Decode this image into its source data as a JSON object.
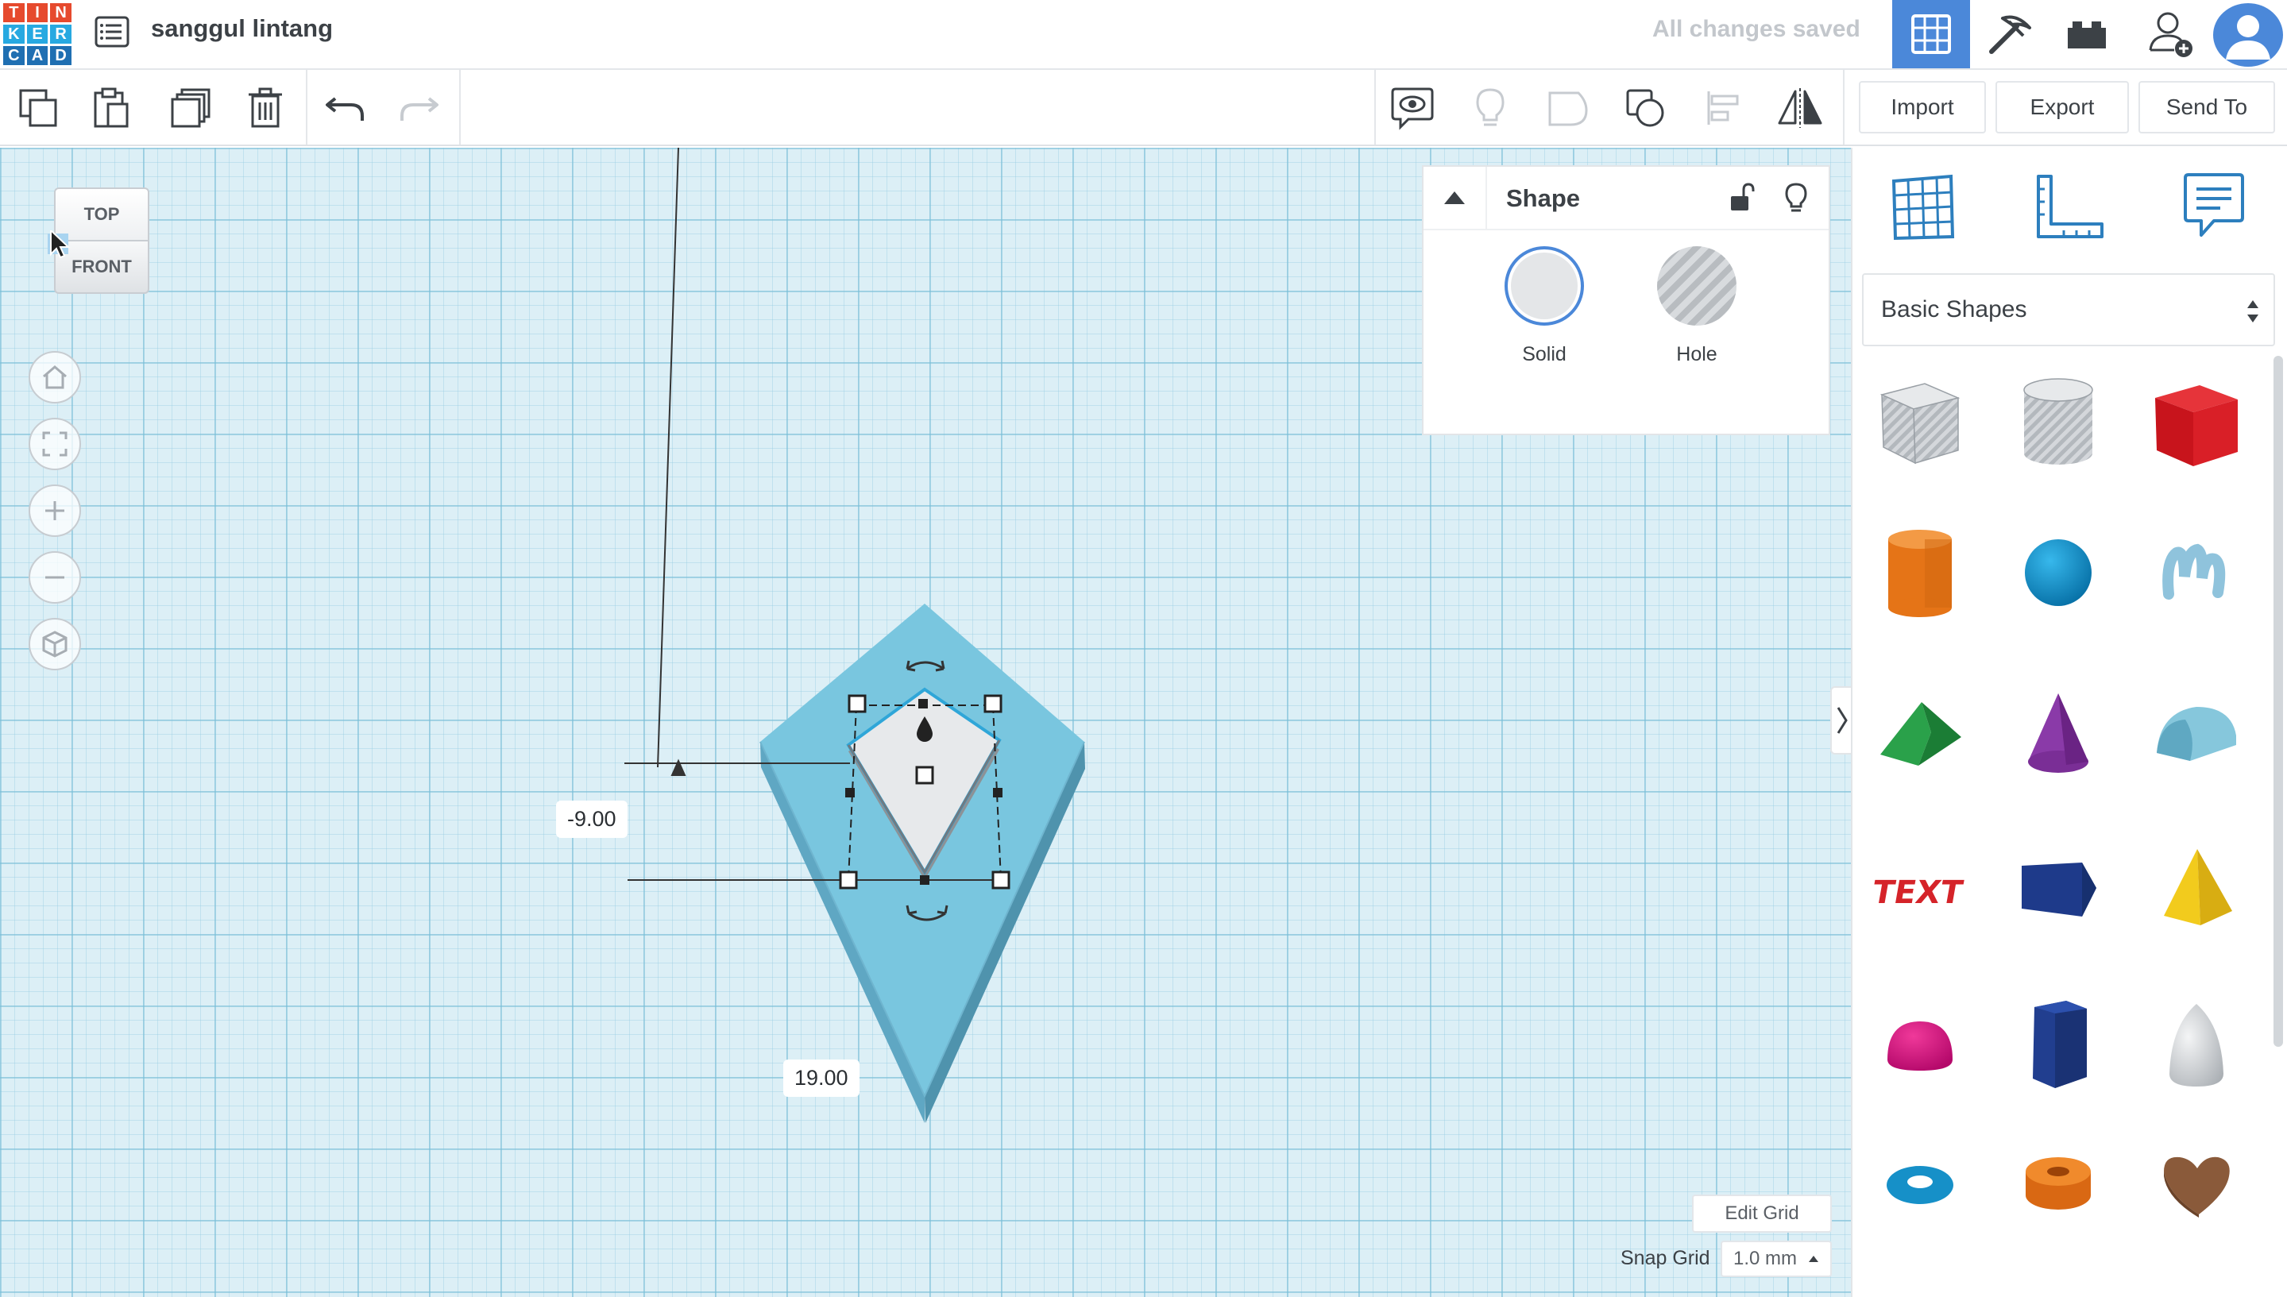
{
  "header": {
    "logo_letters": [
      "T",
      "I",
      "N",
      "K",
      "E",
      "R",
      "C",
      "A",
      "D"
    ],
    "logo_colors": [
      "#e64a2e",
      "#e64a2e",
      "#e64a2e",
      "#27a9e1",
      "#27a9e1",
      "#27a9e1",
      "#1f6fb2",
      "#1f6fb2",
      "#1f6fb2"
    ],
    "design_title": "sanggul lintang",
    "save_status": "All changes saved",
    "accent_color": "#4b88d9"
  },
  "toolbar": {
    "left_icons": [
      "copy-icon",
      "paste-icon",
      "duplicate-icon",
      "trash-icon",
      "undo-icon",
      "redo-icon"
    ],
    "right_icons": [
      "note-icon",
      "light-icon",
      "group-icon",
      "ungroup-icon",
      "align-icon",
      "mirror-icon"
    ],
    "import_label": "Import",
    "export_label": "Export",
    "send_to_label": "Send To"
  },
  "viewcube": {
    "top_label": "TOP",
    "front_label": "FRONT"
  },
  "workplane": {
    "dim_y": "-9.00",
    "dim_x": "19.00",
    "edit_grid_label": "Edit Grid",
    "snap_grid_label": "Snap Grid",
    "snap_grid_value": "1.0 mm"
  },
  "inspector": {
    "title": "Shape",
    "solid_label": "Solid",
    "hole_label": "Hole"
  },
  "library": {
    "selected": "Basic Shapes",
    "shapes": [
      "box-hole",
      "cylinder-hole",
      "box",
      "cylinder",
      "sphere",
      "scribble",
      "roof",
      "cone",
      "round-roof",
      "text",
      "polygon",
      "pyramid",
      "half-sphere",
      "hexagonal-prism",
      "paraboloid",
      "torus",
      "tube",
      "heart"
    ]
  }
}
